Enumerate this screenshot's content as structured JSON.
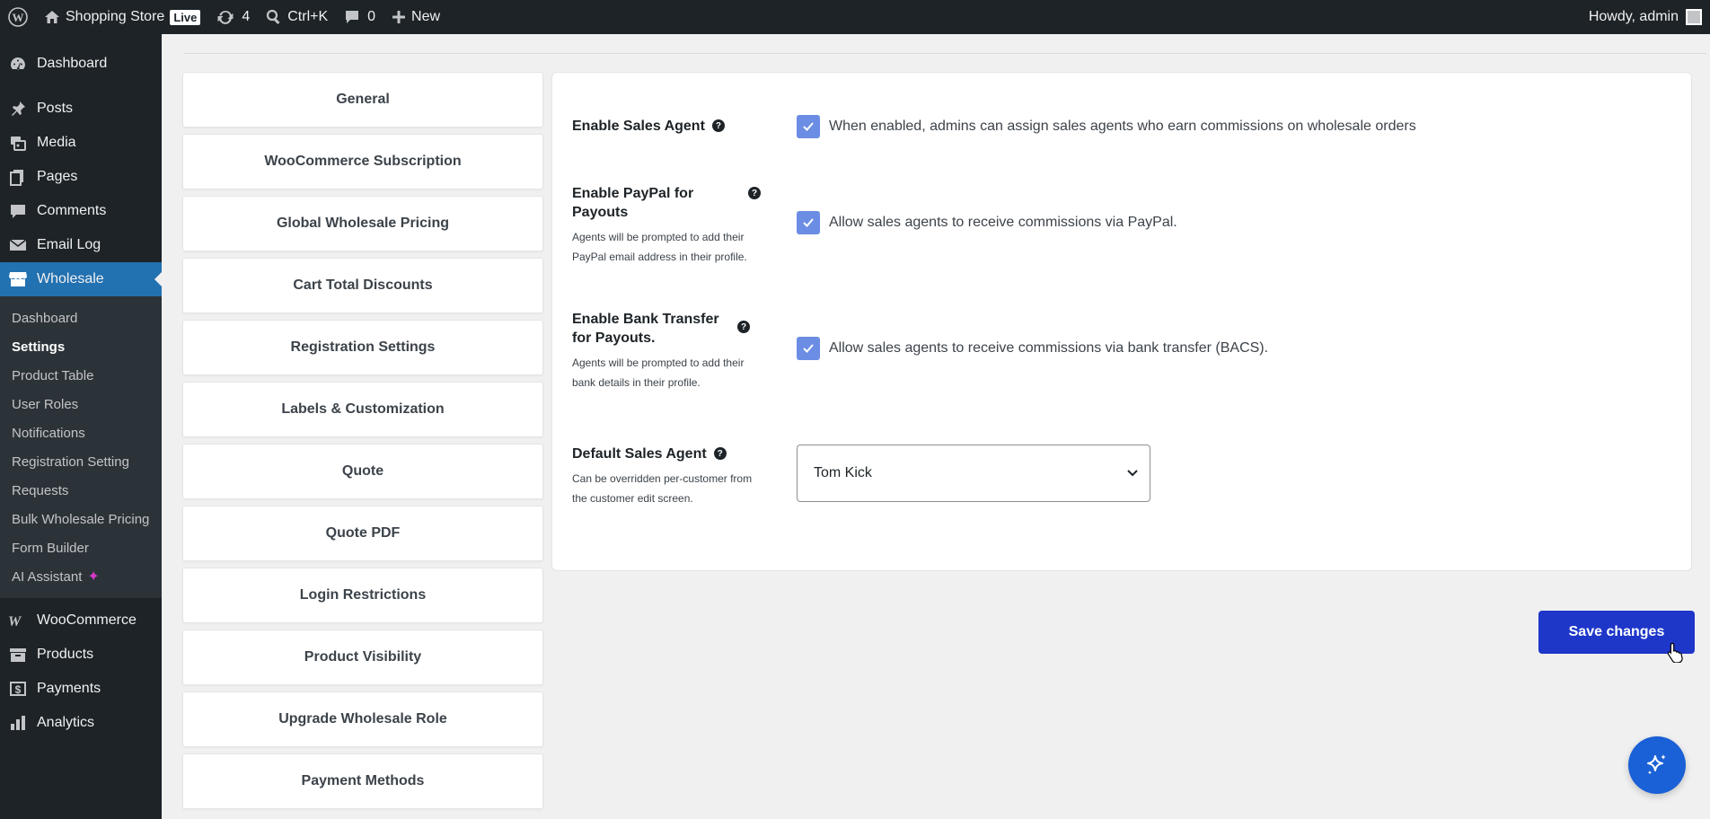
{
  "adminbar": {
    "site_name": "Shopping Store",
    "live_badge": "Live",
    "updates_count": "4",
    "search_shortcut": "Ctrl+K",
    "comments_count": "0",
    "new_label": "New",
    "greeting": "Howdy, admin"
  },
  "sidebar": {
    "items_top": [
      {
        "label": "Dashboard",
        "icon": "dashboard-icon"
      },
      {
        "label": "Posts",
        "icon": "pin-icon"
      },
      {
        "label": "Media",
        "icon": "media-icon"
      },
      {
        "label": "Pages",
        "icon": "pages-icon"
      },
      {
        "label": "Comments",
        "icon": "comment-icon"
      },
      {
        "label": "Email Log",
        "icon": "email-icon"
      },
      {
        "label": "Wholesale",
        "icon": "store-icon"
      }
    ],
    "submenu": [
      "Dashboard",
      "Settings",
      "Product Table",
      "User Roles",
      "Notifications",
      "Registration Setting",
      "Requests",
      "Bulk Wholesale Pricing",
      "Form Builder",
      "AI Assistant"
    ],
    "items_bottom": [
      {
        "label": "WooCommerce",
        "icon": "woocommerce-icon"
      },
      {
        "label": "Products",
        "icon": "archive-icon"
      },
      {
        "label": "Payments",
        "icon": "payment-icon"
      },
      {
        "label": "Analytics",
        "icon": "chart-icon"
      }
    ],
    "active_color": "#2271b1"
  },
  "tabs": [
    "General",
    "WooCommerce Subscription",
    "Global Wholesale Pricing",
    "Cart Total Discounts",
    "Registration Settings",
    "Labels & Customization",
    "Quote",
    "Quote PDF",
    "Login Restrictions",
    "Product Visibility",
    "Upgrade Wholesale Role",
    "Payment Methods"
  ],
  "settings": {
    "sales_agent": {
      "label": "Enable Sales Agent",
      "checkbox_label": "When enabled, admins can assign sales agents who earn commissions on wholesale orders",
      "checked": true
    },
    "paypal": {
      "label": "Enable PayPal for Payouts",
      "desc": "Agents will be prompted to add their PayPal email address in their profile.",
      "checkbox_label": "Allow sales agents to receive commissions via PayPal.",
      "checked": true
    },
    "bank": {
      "label": "Enable Bank Transfer for Payouts.",
      "desc": "Agents will be prompted to add their bank details in their profile.",
      "checkbox_label": "Allow sales agents to receive commissions via bank transfer (BACS).",
      "checked": true
    },
    "default_agent": {
      "label": "Default Sales Agent",
      "desc": "Can be overridden per-customer from the customer edit screen.",
      "value": "Tom Kick"
    }
  },
  "save_label": "Save changes",
  "colors": {
    "accent": "#1e37c9",
    "checkbox": "#6b8de3",
    "fab": "#1a60d6"
  }
}
